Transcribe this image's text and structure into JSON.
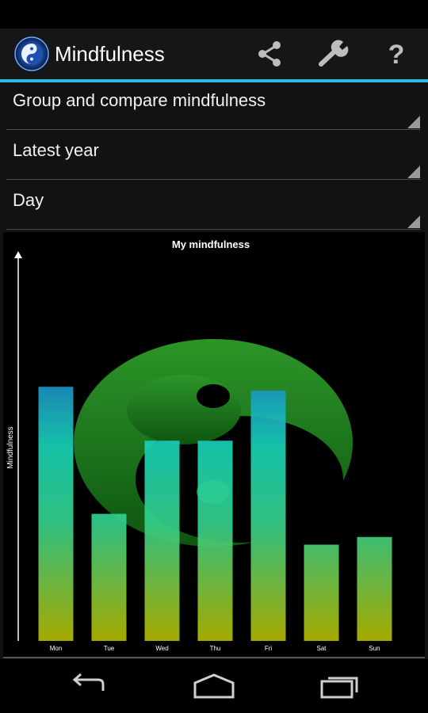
{
  "app": {
    "title": "Mindfulness",
    "logo_icon": "yin-yang-icon",
    "accent_color": "#33b5e5"
  },
  "toolbar": {
    "share_icon": "share-icon",
    "settings_icon": "wrench-icon",
    "help_icon": "help-icon"
  },
  "spinners": [
    {
      "label": "Group and compare mindfulness"
    },
    {
      "label": "Latest year"
    },
    {
      "label": "Day"
    }
  ],
  "chart_data": {
    "type": "bar",
    "title": "My mindfulness",
    "xlabel": "",
    "ylabel": "Mindfulness",
    "categories": [
      "Mon",
      "Tue",
      "Wed",
      "Thu",
      "Fri",
      "Sat",
      "Sun"
    ],
    "values": [
      66,
      33,
      52,
      52,
      65,
      25,
      27
    ],
    "ylim": [
      0,
      100
    ],
    "grid": false,
    "legend": "none",
    "background_watermark": "yin-yang-icon",
    "bar_gradient": [
      "#b4b800",
      "#1db0d0"
    ]
  },
  "nav": {
    "back_icon": "back-icon",
    "home_icon": "home-icon",
    "recents_icon": "recent-apps-icon"
  }
}
